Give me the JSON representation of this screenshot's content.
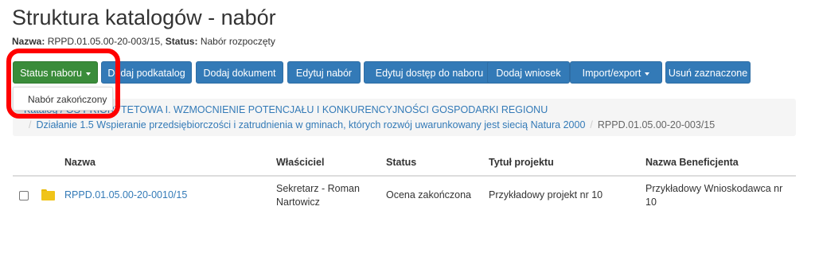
{
  "page": {
    "title": "Struktura katalogów - nabór",
    "meta": {
      "name_label": "Nazwa:",
      "name_value": "RPPD.01.05.00-20-003/15,",
      "status_label": "Status:",
      "status_value": "Nabór rozpoczęty"
    }
  },
  "toolbar": {
    "status_button": "Status naboru",
    "add_subcatalog": "Dodaj podkatalog",
    "add_document": "Dodaj dokument",
    "edit_call": "Edytuj nabór",
    "edit_access": "Edytuj dostęp do naboru",
    "add_application": "Dodaj wniosek",
    "import_export": "Import/export",
    "delete_selected": "Usuń zaznaczone"
  },
  "dropdown": {
    "items": [
      "Nabór zakończony"
    ]
  },
  "breadcrumb": {
    "line1": "Katalog / OŚ PRIORYTETOWA I. WZMOCNIENIE POTENCJAŁU I KONKURENCYJNOŚCI GOSPODARKI REGIONU",
    "line2_link": "Działanie 1.5 Wspieranie przedsiębiorczości i zatrudnienia w gminach, których rozwój uwarunkowany jest siecią Natura 2000",
    "line2_current": "RPPD.01.05.00-20-003/15"
  },
  "table": {
    "headers": {
      "name": "Nazwa",
      "owner": "Właściciel",
      "status": "Status",
      "project_title": "Tytuł projektu",
      "beneficiary": "Nazwa Beneficjenta"
    },
    "rows": [
      {
        "name": "RPPD.01.05.00-20-0010/15",
        "owner": "Sekretarz - Roman Nartowicz",
        "status": "Ocena zakończona",
        "project_title": "Przykładowy projekt nr 10",
        "beneficiary": "Przykładowy Wnioskodawca nr 10"
      }
    ]
  },
  "colors": {
    "primary": "#337ab7",
    "success": "#3a8c3a",
    "highlight": "#ff0000"
  },
  "icons": {
    "folder": "folder-icon",
    "caret": "caret-down-icon"
  }
}
